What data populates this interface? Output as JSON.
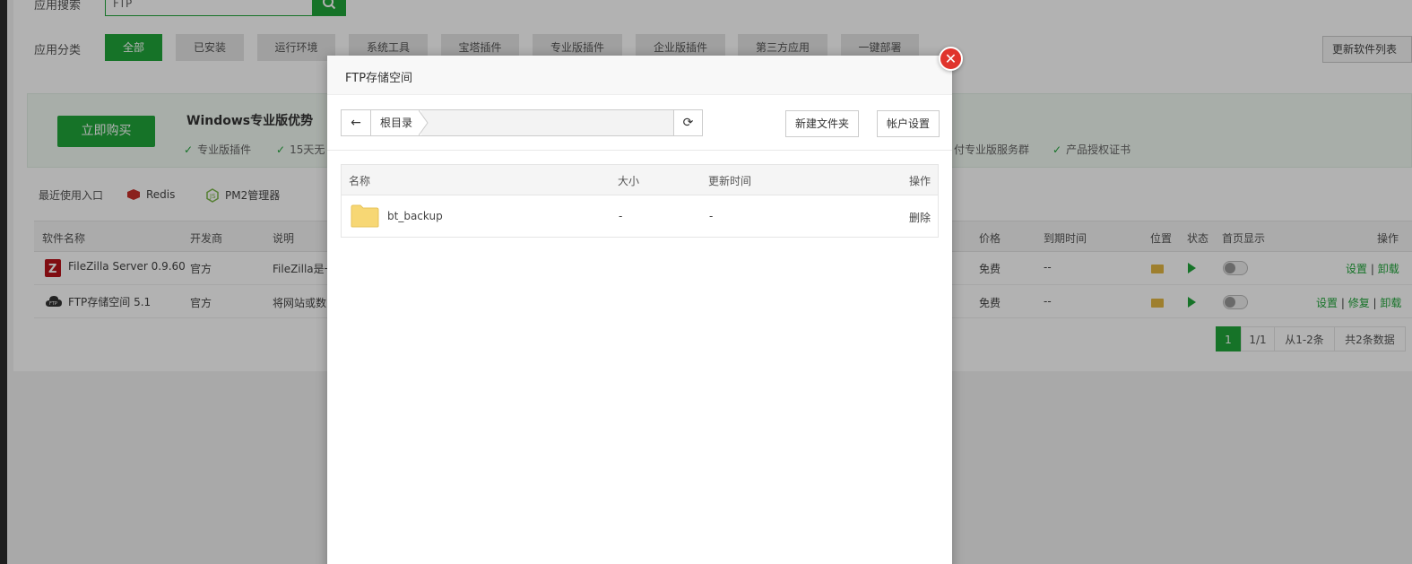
{
  "search": {
    "label": "应用搜索",
    "value": "FTP"
  },
  "categories": {
    "label": "应用分类",
    "items": [
      "全部",
      "已安装",
      "运行环境",
      "系统工具",
      "宝塔插件",
      "专业版插件",
      "企业版插件",
      "第三方应用",
      "一键部署"
    ],
    "refresh_label": "更新软件列表"
  },
  "promo": {
    "buy_label": "立即购买",
    "title": "Windows专业版优势",
    "features": [
      "专业版插件",
      "15天无",
      "付专业版服务群",
      "产品授权证书"
    ]
  },
  "recent": {
    "label": "最近使用入口",
    "items": [
      "Redis",
      "PM2管理器"
    ]
  },
  "software_table": {
    "headers": {
      "name": "软件名称",
      "dev": "开发商",
      "desc": "说明",
      "price": "价格",
      "expire": "到期时间",
      "location": "位置",
      "status": "状态",
      "home": "首页显示",
      "ops": "操作"
    },
    "rows": [
      {
        "name": "FileZilla Server 0.9.60",
        "dev": "官方",
        "desc": "FileZilla是一",
        "price": "免费",
        "expire": "--",
        "op1": "设置",
        "op2": "卸载",
        "op3": ""
      },
      {
        "name": "FTP存储空间 5.1",
        "dev": "官方",
        "desc": "将网站或数",
        "price": "免费",
        "expire": "--",
        "op1": "设置",
        "op2": "修复",
        "op3": "卸载"
      }
    ],
    "pager": {
      "current": "1",
      "pages": "1/1",
      "range": "从1-2条",
      "total": "共2条数据"
    }
  },
  "modal": {
    "title": "FTP存储空间",
    "crumb": "根目录",
    "new_folder": "新建文件夹",
    "account_settings": "帐户设置",
    "table": {
      "headers": {
        "name": "名称",
        "size": "大小",
        "time": "更新时间",
        "ops": "操作"
      },
      "rows": [
        {
          "name": "bt_backup",
          "size": "-",
          "time": "-",
          "op": "删除"
        }
      ]
    }
  },
  "icons": [
    "search-icon",
    "check-icon",
    "redis-icon",
    "pm2-icon",
    "filezilla-icon",
    "ftp-icon",
    "folder-icon",
    "play-icon",
    "back-arrow-icon",
    "refresh-icon",
    "close-icon"
  ],
  "colors": {
    "accent": "#20a53a",
    "close": "#e0342d",
    "folder": "#f7d774"
  }
}
